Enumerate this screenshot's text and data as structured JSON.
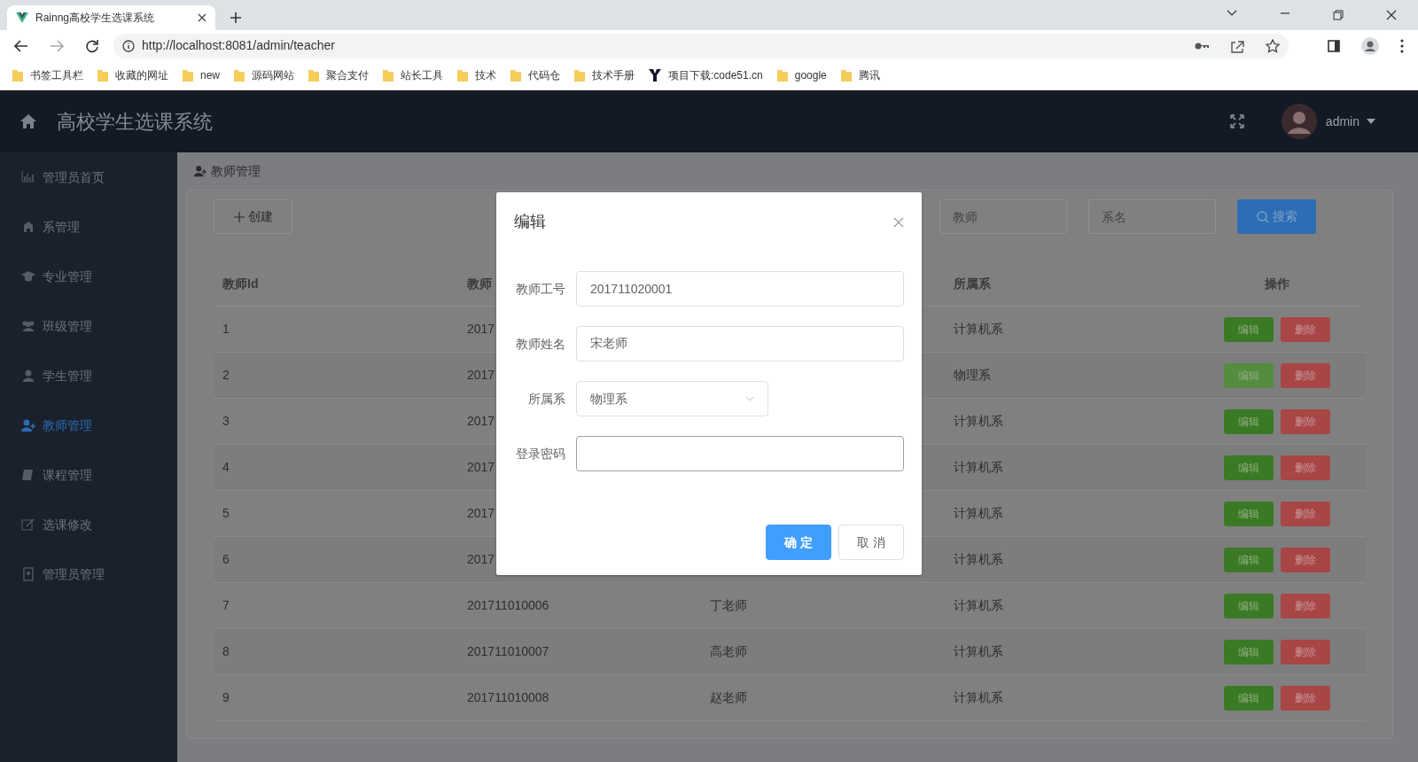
{
  "browser": {
    "tab": {
      "title": "Rainng高校学生选课系统"
    },
    "url": "http://localhost:8081/admin/teacher",
    "bookmarks": [
      {
        "label": "书签工具栏",
        "kind": "folder"
      },
      {
        "label": "收藏的网址",
        "kind": "folder"
      },
      {
        "label": "new",
        "kind": "folder"
      },
      {
        "label": "源码网站",
        "kind": "folder"
      },
      {
        "label": "聚合支付",
        "kind": "folder"
      },
      {
        "label": "站长工具",
        "kind": "folder"
      },
      {
        "label": "技术",
        "kind": "folder"
      },
      {
        "label": "代码仓",
        "kind": "folder"
      },
      {
        "label": "技术手册",
        "kind": "folder"
      },
      {
        "label": "项目下载:code51.cn",
        "kind": "site"
      },
      {
        "label": "google",
        "kind": "folder"
      },
      {
        "label": "腾讯",
        "kind": "folder"
      }
    ]
  },
  "app": {
    "title": "高校学生选课系统",
    "user": "admin"
  },
  "sidebar": {
    "items": [
      {
        "label": "管理员首页",
        "selected": false
      },
      {
        "label": "系管理",
        "selected": false
      },
      {
        "label": "专业管理",
        "selected": false
      },
      {
        "label": "班级管理",
        "selected": false
      },
      {
        "label": "学生管理",
        "selected": false
      },
      {
        "label": "教师管理",
        "selected": true
      },
      {
        "label": "课程管理",
        "selected": false
      },
      {
        "label": "选课修改",
        "selected": false
      },
      {
        "label": "管理员管理",
        "selected": false
      }
    ]
  },
  "breadcrumb": "教师管理",
  "toolbar": {
    "create_button": "创建",
    "search_fields": [
      {
        "placeholder": "教师"
      },
      {
        "placeholder": "系名"
      }
    ],
    "search_button": "搜索"
  },
  "table": {
    "columns": [
      "教师Id",
      "教师",
      null,
      "所属系",
      "操作"
    ],
    "rows": [
      {
        "cells": [
          "1",
          "2017",
          null,
          "计算机系"
        ],
        "actions": [
          {
            "label": "编辑",
            "kind": "edit",
            "hovered": false
          },
          {
            "label": "删除",
            "kind": "delete",
            "hovered": false
          }
        ]
      },
      {
        "cells": [
          "2",
          "2017",
          null,
          "物理系"
        ],
        "actions": [
          {
            "label": "编辑",
            "kind": "edit",
            "hovered": true
          },
          {
            "label": "删除",
            "kind": "delete",
            "hovered": false
          }
        ]
      },
      {
        "cells": [
          "3",
          "2017",
          null,
          "计算机系"
        ],
        "actions": [
          {
            "label": "编辑",
            "kind": "edit",
            "hovered": false
          },
          {
            "label": "删除",
            "kind": "delete",
            "hovered": false
          }
        ]
      },
      {
        "cells": [
          "4",
          "2017",
          null,
          "计算机系"
        ],
        "actions": [
          {
            "label": "编辑",
            "kind": "edit",
            "hovered": false
          },
          {
            "label": "删除",
            "kind": "delete",
            "hovered": false
          }
        ]
      },
      {
        "cells": [
          "5",
          "2017",
          null,
          "计算机系"
        ],
        "actions": [
          {
            "label": "编辑",
            "kind": "edit",
            "hovered": false
          },
          {
            "label": "删除",
            "kind": "delete",
            "hovered": false
          }
        ]
      },
      {
        "cells": [
          "6",
          "2017",
          null,
          "计算机系"
        ],
        "actions": [
          {
            "label": "编辑",
            "kind": "edit",
            "hovered": false
          },
          {
            "label": "删除",
            "kind": "delete",
            "hovered": false
          }
        ]
      },
      {
        "cells": [
          "7",
          "201711010006",
          "丁老师",
          "计算机系"
        ],
        "actions": [
          {
            "label": "编辑",
            "kind": "edit",
            "hovered": false
          },
          {
            "label": "删除",
            "kind": "delete",
            "hovered": false
          }
        ]
      },
      {
        "cells": [
          "8",
          "201711010007",
          "高老师",
          "计算机系"
        ],
        "actions": [
          {
            "label": "编辑",
            "kind": "edit",
            "hovered": false
          },
          {
            "label": "删除",
            "kind": "delete",
            "hovered": false
          }
        ]
      },
      {
        "cells": [
          "9",
          "201711010008",
          "赵老师",
          "计算机系"
        ],
        "actions": [
          {
            "label": "编辑",
            "kind": "edit",
            "hovered": false
          },
          {
            "label": "删除",
            "kind": "delete",
            "hovered": false
          }
        ]
      }
    ]
  },
  "dialog": {
    "title": "编辑",
    "fields": [
      {
        "label": "教师工号",
        "kind": "text",
        "value": "201711020001",
        "focused": false
      },
      {
        "label": "教师姓名",
        "kind": "text",
        "value": "宋老师",
        "focused": false
      },
      {
        "label": "所属系",
        "kind": "select",
        "value": "物理系",
        "focused": false
      },
      {
        "label": "登录密码",
        "kind": "text",
        "focused": true
      }
    ],
    "buttons": [
      {
        "label": "确 定",
        "kind": "primary"
      },
      {
        "label": "取 消",
        "kind": "default"
      }
    ]
  }
}
